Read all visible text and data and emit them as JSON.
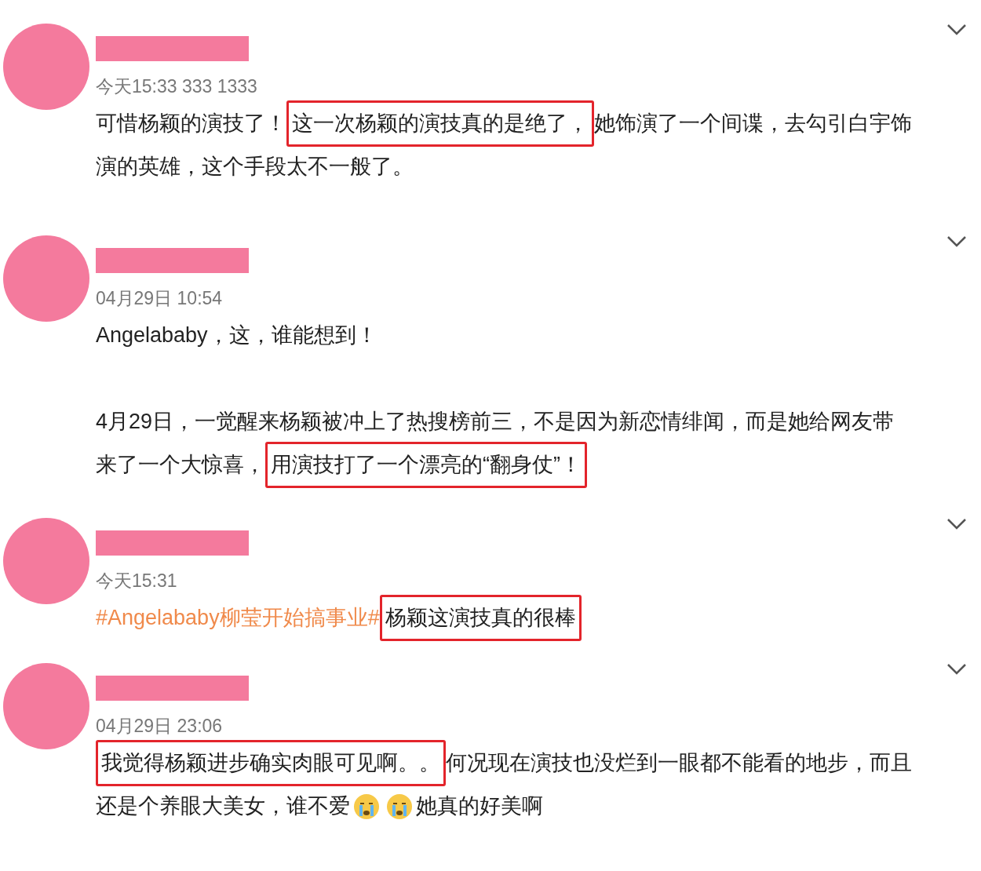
{
  "comments": [
    {
      "time": "今天15:33 333 1333",
      "paragraphs": [
        [
          [
            {
              "kind": "text",
              "text": "可惜杨颖的演技了！",
              "highlighted": false
            },
            {
              "kind": "text",
              "text": "这一次杨颖的演技真的是绝了，",
              "highlighted": true
            },
            {
              "kind": "text",
              "text": "她饰演了一个间谍，去勾引白宇饰",
              "highlighted": false
            }
          ],
          [
            {
              "kind": "text",
              "text": "演的英雄，这个手段太不一般了。",
              "highlighted": false
            }
          ]
        ]
      ]
    },
    {
      "time": "04月29日 10:54",
      "paragraphs": [
        [
          [
            {
              "kind": "text",
              "text": "Angelababy，这，谁能想到！",
              "highlighted": false
            }
          ]
        ],
        [
          [
            {
              "kind": "text",
              "text": "4月29日，一觉醒来杨颖被冲上了热搜榜前三，不是因为新恋情绯闻，而是她给网友带",
              "highlighted": false
            }
          ],
          [
            {
              "kind": "text",
              "text": "来了一个大惊喜，",
              "highlighted": false
            },
            {
              "kind": "text",
              "text": "用演技打了一个漂亮的“翻身仗”！",
              "highlighted": true
            }
          ]
        ]
      ]
    },
    {
      "time": "今天15:31",
      "paragraphs": [
        [
          [
            {
              "kind": "hashtag",
              "text": "#Angelababy柳莹开始搞事业#",
              "highlighted": false
            },
            {
              "kind": "text",
              "text": "杨颖这演技真的很棒",
              "highlighted": true
            }
          ]
        ]
      ]
    },
    {
      "time": "04月29日 23:06",
      "paragraphs": [
        [
          [
            {
              "kind": "text",
              "text": "我觉得杨颖进步确实肉眼可见啊。。",
              "highlighted": true
            },
            {
              "kind": "text",
              "text": "何况现在演技也没烂到一眼都不能看的地步，而且",
              "highlighted": false
            }
          ],
          [
            {
              "kind": "text",
              "text": "还是个养眼大美女，谁不爱",
              "highlighted": false
            },
            {
              "kind": "emoji"
            },
            {
              "kind": "emoji"
            },
            {
              "kind": "text",
              "text": "她真的好美啊",
              "highlighted": false
            }
          ]
        ]
      ]
    }
  ]
}
